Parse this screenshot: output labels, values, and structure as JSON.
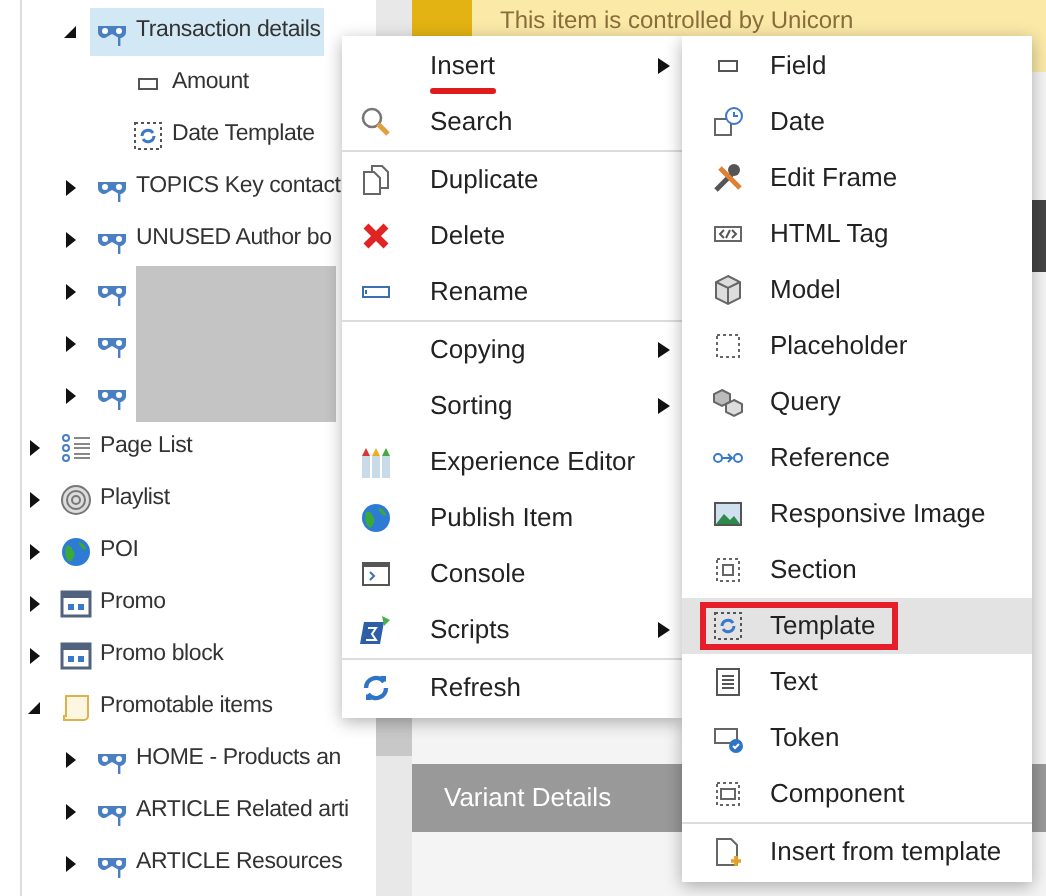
{
  "banner": {
    "text": "This item is controlled by Unicorn"
  },
  "partial_branch": [
    {
      "label": "Transaction details",
      "kind": "rendering",
      "expanded": true,
      "selected": true,
      "children": [
        {
          "label": "Amount",
          "kind": "field",
          "selected": false
        },
        {
          "label": "Date Template",
          "kind": "template",
          "selected": false
        }
      ]
    },
    {
      "label": "TOPICS Key contact",
      "kind": "rendering",
      "expanded": false,
      "selected": false
    },
    {
      "label": "UNUSED Author bo",
      "kind": "rendering",
      "expanded": false,
      "selected": false
    },
    {
      "kind": "rendering",
      "redacted": true,
      "expanded": false,
      "selected": false
    },
    {
      "kind": "rendering",
      "redacted": true,
      "expanded": false,
      "selected": false
    },
    {
      "kind": "rendering",
      "redacted": true,
      "expanded": false,
      "selected": false
    }
  ],
  "tree": [
    {
      "label": "Page List",
      "kind": "list",
      "expanded": false,
      "selected": false
    },
    {
      "label": "Playlist",
      "kind": "disc",
      "expanded": false,
      "selected": false
    },
    {
      "label": "POI",
      "kind": "globe",
      "expanded": false,
      "selected": false
    },
    {
      "label": "Promo",
      "kind": "promo",
      "expanded": false,
      "selected": false
    },
    {
      "label": "Promo block",
      "kind": "promo",
      "expanded": false,
      "selected": false
    },
    {
      "label": "Promotable items",
      "kind": "scroll",
      "expanded": true,
      "selected": false,
      "children": [
        {
          "label": "HOME - Products an",
          "kind": "rendering",
          "expanded": false,
          "selected": false
        },
        {
          "label": "ARTICLE Related arti",
          "kind": "rendering",
          "expanded": false,
          "selected": false
        },
        {
          "label": "ARTICLE Resources",
          "kind": "rendering",
          "expanded": false,
          "selected": false
        }
      ]
    }
  ],
  "section_header": {
    "text": "Variant Details"
  },
  "context_menu": [
    [
      {
        "label": "Insert",
        "kind": "none",
        "submenu": true,
        "annotated": true
      },
      {
        "label": "Search",
        "kind": "search",
        "submenu": false
      }
    ],
    [
      {
        "label": "Duplicate",
        "kind": "duplicate",
        "submenu": false
      },
      {
        "label": "Delete",
        "kind": "delete",
        "submenu": false
      },
      {
        "label": "Rename",
        "kind": "rename",
        "submenu": false
      }
    ],
    [
      {
        "label": "Copying",
        "kind": "none",
        "submenu": true
      },
      {
        "label": "Sorting",
        "kind": "none",
        "submenu": true
      },
      {
        "label": "Experience Editor",
        "kind": "crayons",
        "submenu": false
      },
      {
        "label": "Publish Item",
        "kind": "globe",
        "submenu": false
      },
      {
        "label": "Console",
        "kind": "console",
        "submenu": false
      },
      {
        "label": "Scripts",
        "kind": "scripts",
        "submenu": true
      }
    ],
    [
      {
        "label": "Refresh",
        "kind": "refresh",
        "submenu": false
      }
    ]
  ],
  "insert_submenu": [
    [
      {
        "label": "Field",
        "kind": "field",
        "selected": false
      },
      {
        "label": "Date",
        "kind": "date",
        "selected": false
      },
      {
        "label": "Edit Frame",
        "kind": "tools",
        "selected": false
      },
      {
        "label": "HTML Tag",
        "kind": "code",
        "selected": false
      },
      {
        "label": "Model",
        "kind": "cube",
        "selected": false
      },
      {
        "label": "Placeholder",
        "kind": "dashed",
        "selected": false
      },
      {
        "label": "Query",
        "kind": "query",
        "selected": false
      },
      {
        "label": "Reference",
        "kind": "reference",
        "selected": false
      },
      {
        "label": "Responsive Image",
        "kind": "image",
        "selected": false
      },
      {
        "label": "Section",
        "kind": "section",
        "selected": false
      },
      {
        "label": "Template",
        "kind": "template",
        "selected": true,
        "annotated": true
      },
      {
        "label": "Text",
        "kind": "text",
        "selected": false
      },
      {
        "label": "Token",
        "kind": "token",
        "selected": false
      },
      {
        "label": "Component",
        "kind": "component",
        "selected": false
      }
    ],
    [
      {
        "label": "Insert from template",
        "kind": "newfile",
        "selected": false
      }
    ]
  ]
}
